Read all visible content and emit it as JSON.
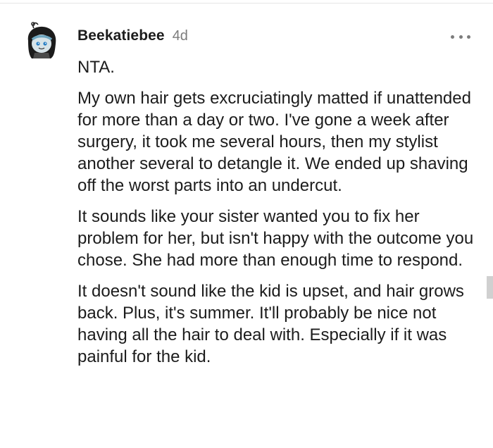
{
  "comment": {
    "author": "Beekatiebee",
    "age": "4d",
    "more_menu_icon": "ellipsis-horizontal-icon",
    "avatar_icon": "snoo-avatar-icon",
    "paragraphs": [
      "NTA.",
      "My own hair gets excruciatingly matted if unattended for more than a day or two. I've gone a week after surgery, it took me several hours, then my stylist another several to detangle it. We ended up shaving off the worst parts into an undercut.",
      "It sounds like your sister wanted you to fix her problem for her, but isn't happy with the outcome you chose. She had more than enough time to respond.",
      "It doesn't sound like the kid is upset, and hair grows back. Plus, it's summer. It'll probably be nice not having all the hair to deal with. Especially if it was painful for the kid."
    ]
  },
  "colors": {
    "text": "#1c1c1c",
    "meta": "#7c7c7c",
    "background": "#ffffff"
  }
}
